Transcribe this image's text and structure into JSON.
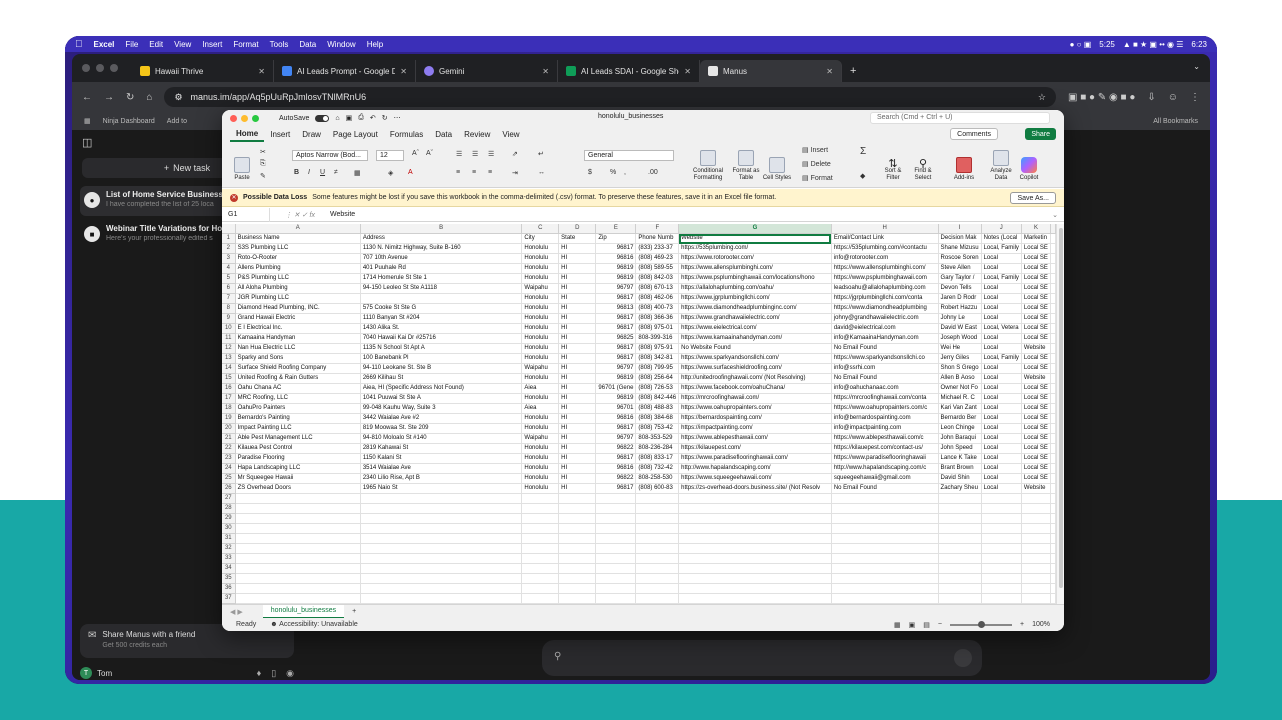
{
  "menubar": {
    "app": "Excel",
    "items": [
      "File",
      "Edit",
      "View",
      "Insert",
      "Format",
      "Tools",
      "Data",
      "Window",
      "Help"
    ],
    "timer": "5:25",
    "clock": "6:23"
  },
  "browser": {
    "tabs": [
      {
        "label": "Hawaii Thrive",
        "color": "#f5c518"
      },
      {
        "label": "AI Leads Prompt - Google Do",
        "color": "#4285f4"
      },
      {
        "label": "Gemini",
        "color": "#8e7cf0"
      },
      {
        "label": "AI Leads SDAI - Google Shee",
        "color": "#0f9d58"
      },
      {
        "label": "Manus",
        "color": "#e6e6e6"
      }
    ],
    "url": "manus.im/app/Aq5pUuRpJmlosvTNlMRnU6",
    "bookmarks": [
      "Ninja Dashboard",
      "Add to"
    ],
    "all_bookmarks": "All Bookmarks"
  },
  "manus": {
    "new_task": "New task",
    "tasks": [
      {
        "title": "List of Home Service Business",
        "sub": "I have completed the list of 25 loca"
      },
      {
        "title": "Webinar Title Variations for Ho",
        "sub": "Here's your professionally edited s"
      }
    ],
    "share_title": "Share Manus with a friend",
    "share_sub": "Get 500 credits each",
    "user": "Tom",
    "user_initial": "T"
  },
  "excel": {
    "autosave": "AutoSave",
    "filename": "honolulu_businesses",
    "search": "Search (Cmd + Ctrl + U)",
    "ribbon_tabs": [
      "Home",
      "Insert",
      "Draw",
      "Page Layout",
      "Formulas",
      "Data",
      "Review",
      "View"
    ],
    "comments": "Comments",
    "share": "Share",
    "font": "Aptos Narrow (Bod...",
    "font_size": "12",
    "number_format": "General",
    "ribbon_labels": {
      "paste": "Paste",
      "cond": "Conditional Formatting",
      "fmt_table": "Format as Table",
      "cell_styles": "Cell Styles",
      "insert": "Insert",
      "delete": "Delete",
      "format": "Format",
      "sort": "Sort & Filter",
      "find": "Find & Select",
      "addins": "Add-ins",
      "analyze": "Analyze Data",
      "copilot": "Copilot"
    },
    "warning_bold": "Possible Data Loss",
    "warning_text": "Some features might be lost if you save this workbook in the comma-delimited (.csv) format. To preserve these features, save it in an Excel file format.",
    "save_as": "Save As...",
    "cell_ref": "G1",
    "formula": "Website",
    "columns": [
      "A",
      "B",
      "C",
      "D",
      "E",
      "F",
      "G",
      "H",
      "I",
      "J",
      "K"
    ],
    "rows": [
      [
        "Business Name",
        "Address",
        "City",
        "State",
        "Zip",
        "Phone Numb",
        "Website",
        "Email/Contact Link",
        "Decision Mak",
        "Notes (Local",
        "Marketin"
      ],
      [
        "S3S Plumbing LLC",
        "1130 N. Nimitz Highway, Suite B-160",
        "Honolulu",
        "HI",
        "96817",
        "(833) 233-37",
        "https://535plumbing.com/",
        "https://535plumbing.com/#contactu",
        "Shane Mizusu",
        "Local, Family",
        "Local SE"
      ],
      [
        "Roto-O-Rooter",
        "707 10th Avenue",
        "Honolulu",
        "HI",
        "96816",
        "(808) 469-23",
        "https://www.rotorooter.com/",
        "info@rotorooter.com",
        "Roscoe Soren",
        "Local",
        "Local SE"
      ],
      [
        "Allens Plumbing",
        "401 Puuhale Rd",
        "Honolulu",
        "HI",
        "96819",
        "(808) 589-55",
        "https://www.allensplumbinghi.com/",
        "https://www.allensplumbinghi.com/",
        "Steve Allen",
        "Local",
        "Local SE"
      ],
      [
        "P&S Plumbing LLC",
        "1714 Homerule St Ste 1",
        "Honolulu",
        "HI",
        "96819",
        "(808) 842-03",
        "https://www.psplumbinghawaii.com/locations/hono",
        "https://www.psplumbinghawaii.com",
        "Gary Taylor /",
        "Local, Family",
        "Local SE"
      ],
      [
        "All Aloha Plumbing",
        "94-150 Leoleo St Ste A1118",
        "Waipahu",
        "HI",
        "96797",
        "(808) 670-13",
        "https://allalohaplumbing.com/oahu/",
        "leadsoahu@allalohaplumbing.com",
        "Devon Tells",
        "Local",
        "Local SE"
      ],
      [
        "JGR Plumbing LLC",
        "",
        "Honolulu",
        "HI",
        "96817",
        "(808) 462-06",
        "https://www.jgrplumbingllchi.com/",
        "https://jgrplumbingllchi.com/conta",
        "Jaren D Rodr",
        "Local",
        "Local SE"
      ],
      [
        "Diamond Head Plumbing, INC.",
        "575 Cooke St Ste G",
        "Honolulu",
        "HI",
        "96813",
        "(808) 400-73",
        "https://www.diamondheadplumbinginc.com/",
        "https://www.diamondheadplumbing",
        "Robert Hazzu",
        "Local",
        "Local SE"
      ],
      [
        "Grand Hawaii Electric",
        "1110 Banyan St #204",
        "Honolulu",
        "HI",
        "96817",
        "(808) 366-36",
        "https://www.grandhawaiielectric.com/",
        "johny@grandhawaiielectric.com",
        "Johny Le",
        "Local",
        "Local SE"
      ],
      [
        "E I Electrical Inc.",
        "1430 Alika St.",
        "Honolulu",
        "HI",
        "96817",
        "(808) 975-01",
        "https://www.eielectrical.com/",
        "david@eielectrical.com",
        "David W East",
        "Local, Vetera",
        "Local SE"
      ],
      [
        "Kamaaina Handyman",
        "7040 Hawaii Kai Dr #25716",
        "Honolulu",
        "HI",
        "96825",
        "808-399-316",
        "https://www.kamaainahandyman.com/",
        "info@KamaainaHandyman.com",
        "Joseph Wood",
        "Local",
        "Local SE"
      ],
      [
        "Nan Hua Electric LLC",
        "1135 N School St Apt A",
        "Honolulu",
        "HI",
        "96817",
        "(808) 975-91",
        "No Website Found",
        "No Email Found",
        "Wei He",
        "Local",
        "Website"
      ],
      [
        "Sparky and Sons",
        "100 Banebank Pl",
        "Honolulu",
        "HI",
        "96817",
        "(808) 342-81",
        "https://www.sparkyandsonsllchi.com/",
        "https://www.sparkyandsonsllchi.co",
        "Jerry Giles",
        "Local, Family",
        "Local SE"
      ],
      [
        "Surface Shield Roofing Company",
        "94-110 Leokane St. Ste B",
        "Waipahu",
        "HI",
        "96797",
        "(808) 799-95",
        "https://www.surfaceshieldroofing.com/",
        "info@ssrhi.com",
        "Shon S Grego",
        "Local",
        "Local SE"
      ],
      [
        "United Roofing & Rain Gutters",
        "2669 Kilihau St",
        "Honolulu",
        "HI",
        "96819",
        "(808) 256-64",
        "http://unitedroofinghawaii.com/ (Not Resolving)",
        "No Email Found",
        "Allen B Aoso",
        "Local",
        "Website"
      ],
      [
        "Oahu Chana AC",
        "Aiea, HI (Specific Address Not Found)",
        "Aiea",
        "HI",
        "96701 (Gene",
        "(808) 726-53",
        "https://www.facebook.com/oahuChana/",
        "info@oahuchanaac.com",
        "Owner Not Fo",
        "Local",
        "Local SE"
      ],
      [
        "MRC Roofing, LLC",
        "1041 Puuwai St Ste A",
        "Honolulu",
        "HI",
        "96819",
        "(808) 842-446",
        "https://mrcroofinghawaii.com/",
        "https://mrcroofinghawaii.com/conta",
        "Michael R. C",
        "Local",
        "Local SE"
      ],
      [
        "OahuPro Painters",
        "99-048 Kauhu Way, Suite 3",
        "Aiea",
        "HI",
        "96701",
        "(808) 488-83",
        "https://www.oahupropainters.com/",
        "https://www.oahupropainters.com/c",
        "Kari Van Zant",
        "Local",
        "Local SE"
      ],
      [
        "Bernardo's Painting",
        "3442 Waialae Ave #2",
        "Honolulu",
        "HI",
        "96816",
        "(808) 384-68",
        "https://bernardospainting.com/",
        "info@bernardospainting.com",
        "Bernardo Ber",
        "Local",
        "Local SE"
      ],
      [
        "Impact Painting LLC",
        "819 Moowaa St. Ste 209",
        "Honolulu",
        "HI",
        "96817",
        "(808) 753-42",
        "https://impactpainting.com/",
        "info@impactpainting.com",
        "Leon Chinge",
        "Local",
        "Local SE"
      ],
      [
        "Able Pest Management LLC",
        "94-810 Moloalo St #140",
        "Waipahu",
        "HI",
        "96797",
        "808-353-529",
        "https://www.ablepesthawaii.com/",
        "https://www.ablepesthawaii.com/c",
        "John Baraqui",
        "Local",
        "Local SE"
      ],
      [
        "Kilauea Pest Control",
        "2819 Kahawai St",
        "Honolulu",
        "HI",
        "96822",
        "808-236-284",
        "https://kilauepest.com/",
        "https://kilauepest.com/contact-us/",
        "John Speed",
        "Local",
        "Local SE"
      ],
      [
        "Paradise Flooring",
        "1150 Kalani St",
        "Honolulu",
        "HI",
        "96817",
        "(808) 833-17",
        "https://www.paradiseflooringhawaii.com/",
        "https://www.paradiseflooringhawaii",
        "Lance K Take",
        "Local",
        "Local SE"
      ],
      [
        "Hapa Landscaping LLC",
        "3514 Waialae Ave",
        "Honolulu",
        "HI",
        "96816",
        "(808) 732-42",
        "http://www.hapalandscaping.com/",
        "http://www.hapalandscaping.com/c",
        "Brant Brown",
        "Local",
        "Local SE"
      ],
      [
        "Mr Squeegee Hawaii",
        "2340 Lilio Rise, Apt B",
        "Honolulu",
        "HI",
        "96822",
        "808-258-530",
        "https://www.squeegeehawaii.com/",
        "squeegeehawaii@gmail.com",
        "David Shin",
        "Local",
        "Local SE"
      ],
      [
        "ZS Overhead Doors",
        "1965 Naio St",
        "Honolulu",
        "HI",
        "96817",
        "(808) 600-83",
        "https://zs-overhead-doors.business.site/ (Not Resolv",
        "No Email Found",
        "Zachary Sheu",
        "Local",
        "Website"
      ]
    ],
    "empty_row_count": 12,
    "sheet_tab": "honolulu_businesses",
    "status_ready": "Ready",
    "status_access": "Accessibility: Unavailable",
    "zoom": "100%"
  }
}
